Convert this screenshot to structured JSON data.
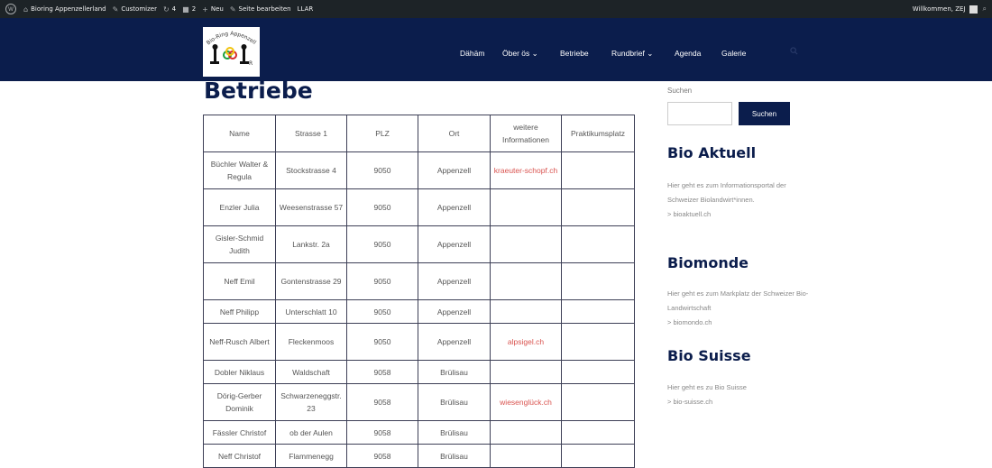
{
  "adminbar": {
    "site_name": "Bioring Appenzellerland",
    "customizer": "Customizer",
    "updates": "4",
    "comments": "2",
    "new": "Neu",
    "edit": "Seite bearbeiten",
    "llar": "LLAR",
    "welcome": "Willkommen, ZEJ"
  },
  "logo": {
    "text": "Bio-Ring Appenzellerland",
    "letter": "R"
  },
  "nav": {
    "items": [
      {
        "label": "Dähäm"
      },
      {
        "label": "Öber ös"
      },
      {
        "label": "Betriebe"
      },
      {
        "label": "Rundbrief"
      },
      {
        "label": "Agenda"
      },
      {
        "label": "Galerie"
      }
    ]
  },
  "main": {
    "title": "Betriebe",
    "table": {
      "headers": [
        "Name",
        "Strasse 1",
        "PLZ",
        "Ort",
        "weitere Informationen",
        "Praktikumsplatz"
      ],
      "rows": [
        [
          "Büchler Walter & Regula",
          "Stockstrasse 4",
          "9050",
          "Appenzell",
          "kraeuter-schopf.ch",
          ""
        ],
        [
          "Enzler Julia",
          "Weesenstrasse 57",
          "9050",
          "Appenzell",
          "",
          ""
        ],
        [
          "Gisler-Schmid Judith",
          "Lankstr. 2a",
          "9050",
          "Appenzell",
          "",
          ""
        ],
        [
          "Neff Emil",
          "Gontenstrasse 29",
          "9050",
          "Appenzell",
          "",
          ""
        ],
        [
          "Neff Philipp",
          "Unterschlatt 10",
          "9050",
          "Appenzell",
          "",
          ""
        ],
        [
          "Neff-Rusch Albert",
          "Fleckenmoos",
          "9050",
          "Appenzell",
          "alpsigel.ch",
          ""
        ],
        [
          "Dobler Niklaus",
          "Waldschaft",
          "9058",
          "Brülisau",
          "",
          ""
        ],
        [
          "Dörig-Gerber Dominik",
          "Schwarzeneggstr. 23",
          "9058",
          "Brülisau",
          "wiesenglück.ch",
          ""
        ],
        [
          "Fässler Christof",
          "ob der Aulen",
          "9058",
          "Brülisau",
          "",
          ""
        ],
        [
          "Neff Christof",
          "Flammenegg",
          "9058",
          "Brülisau",
          "",
          ""
        ]
      ]
    }
  },
  "sidebar": {
    "search_label": "Suchen",
    "search_button": "Suchen",
    "widgets": [
      {
        "title": "Bio Aktuell",
        "text": "Hier geht es zum Informationsportal der Schweizer Biolandwirt*innen.",
        "link": "> bioaktuell.ch"
      },
      {
        "title": "Biomonde",
        "text": "Hier geht es zum Markplatz der Schweizer Bio-Landwirtschaft",
        "link": "> biomondo.ch"
      },
      {
        "title": "Bio Suisse",
        "text": "Hier geht es zu Bio Suisse",
        "link": "> bio-suisse.ch"
      }
    ]
  },
  "colors": {
    "header": "#0b1d4c",
    "adminbar": "#1d2327",
    "link": "#d9534f"
  }
}
